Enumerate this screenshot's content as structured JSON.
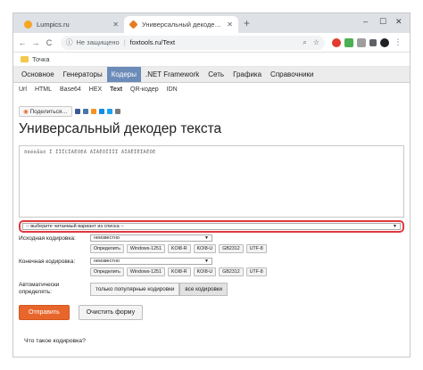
{
  "browser": {
    "tabs": [
      {
        "title": "Lumpics.ru",
        "active": false
      },
      {
        "title": "Универсальный декодер текста",
        "active": true
      }
    ],
    "new_tab": "+",
    "window_controls": [
      "–",
      "☐",
      "✕"
    ],
    "nav": {
      "back": "←",
      "forward": "→",
      "reload": "C"
    },
    "address": {
      "security": "Не защищено",
      "url": "foxtools.ru/Text"
    },
    "bookmark": "Точка"
  },
  "site": {
    "nav": [
      "Основное",
      "Генераторы",
      "Кодеры",
      ".NET Framework",
      "Сеть",
      "Графика",
      "Справочники"
    ],
    "nav_active_index": 2,
    "subnav": [
      "Url",
      "HTML",
      "Base64",
      "HEX",
      "Text",
      "QR-кодер",
      "IDN"
    ],
    "subnav_active_index": 4
  },
  "page": {
    "share_label": "Поделиться…",
    "title": "Универсальный декодер текста",
    "input_text": "ðëêèåàõ Ï ÏÏÏCÏÀÊÓÈÀ ÀÏÀÊÓÏÏÏÏ ÀÏÀËÏÊÏÀÊÓÈ",
    "variant_placeholder": "-- выберите читаемый вариант из списка --",
    "source_label": "Исходная кодировка:",
    "source_value": "неизвестно",
    "target_label": "Конечная кодировка:",
    "target_value": "неизвестно",
    "encoding_buttons": [
      "Определить",
      "Windows-1251",
      "KOI8-R",
      "KOI8-U",
      "GB2312",
      "UTF-8"
    ],
    "auto_label": "Автоматически определять:",
    "auto_options": [
      "только популярные кодировки",
      "все кодировки"
    ],
    "submit": "Отправить",
    "clear": "Очистить форму",
    "faq": "Что такое кодировка?"
  },
  "colors": {
    "accent_orange": "#e8662c",
    "nav_active": "#6b8bb8",
    "highlight_red": "#e0393e"
  }
}
